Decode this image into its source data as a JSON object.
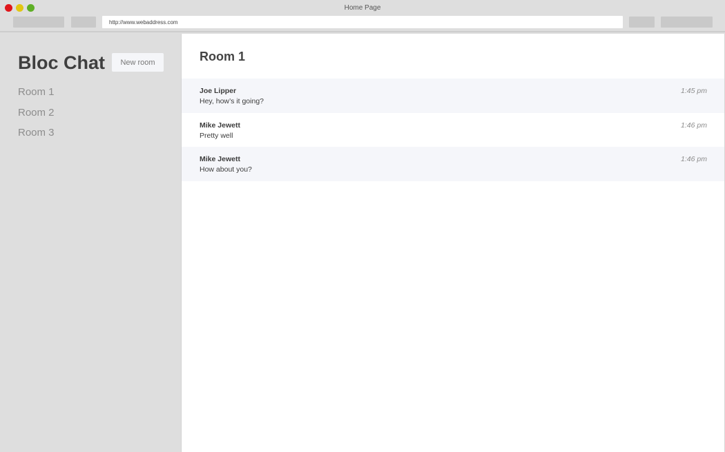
{
  "browser": {
    "window_title": "Home Page",
    "url": "http://www.webaddress.com"
  },
  "sidebar": {
    "app_title": "Bloc Chat",
    "new_room_label": "New room",
    "rooms": [
      {
        "label": "Room 1"
      },
      {
        "label": "Room 2"
      },
      {
        "label": "Room 3"
      }
    ]
  },
  "main": {
    "room_title": "Room 1",
    "messages": [
      {
        "author": "Joe Lipper",
        "text": "Hey, how’s it going?",
        "time": "1:45 pm"
      },
      {
        "author": "Mike Jewett",
        "text": "Pretty well",
        "time": "1:46 pm"
      },
      {
        "author": "Mike Jewett",
        "text": "How about you?",
        "time": "1:46 pm"
      }
    ]
  }
}
